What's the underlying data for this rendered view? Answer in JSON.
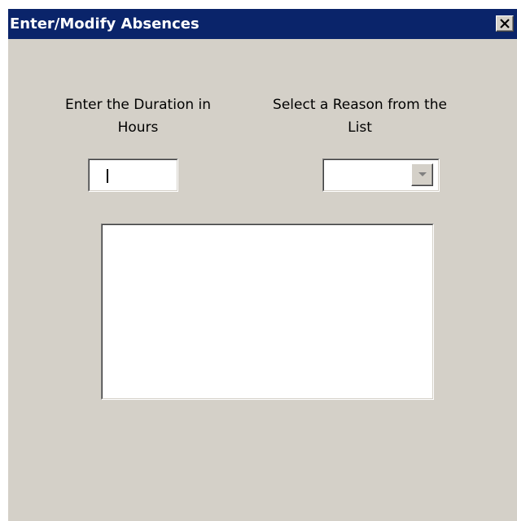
{
  "window": {
    "title": "Enter/Modify Absences"
  },
  "labels": {
    "duration": "Enter the Duration in Hours",
    "reason": "Select a Reason from the List"
  },
  "duration_input": {
    "value": ""
  },
  "reason_select": {
    "selected": ""
  },
  "list_box": {
    "items": []
  },
  "icons": {
    "close": "close-icon",
    "dropdown": "chevron-down-icon"
  },
  "colors": {
    "titlebar": "#0a246a",
    "dialog_bg": "#d4d0c8"
  }
}
